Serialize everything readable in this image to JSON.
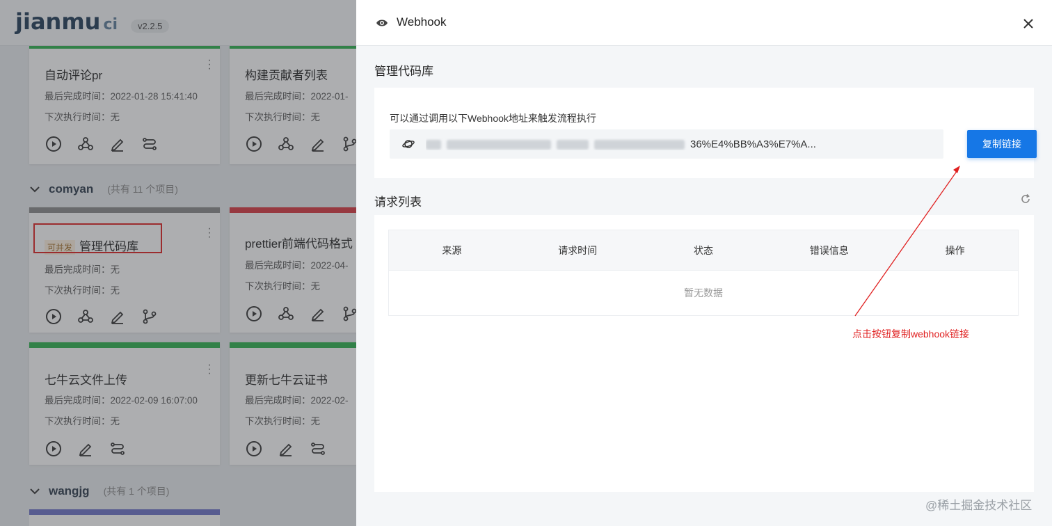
{
  "app": {
    "logo": "jianmu",
    "logo_suffix": "ci",
    "version": "v2.2.5"
  },
  "projects_top": [
    {
      "title": "自动评论pr",
      "last_label": "最后完成时间：",
      "last": "2022-01-28 15:41:40",
      "next_label": "下次执行时间：",
      "next": "无"
    },
    {
      "title": "构建贡献者列表",
      "last_label": "最后完成时间：",
      "last": "2022-01-",
      "next_label": "下次执行时间：",
      "next": "无"
    }
  ],
  "groups": [
    {
      "name": "comyan",
      "count": "(共有 11 个项目)"
    },
    {
      "name": "wangjg",
      "count": "(共有 1 个项目)"
    }
  ],
  "projects_comyan": [
    {
      "tag": "可并发",
      "title": "管理代码库",
      "last_label": "最后完成时间：",
      "last": "无",
      "next_label": "下次执行时间：",
      "next": "无"
    },
    {
      "title": "prettier前端代码格式",
      "last_label": "最后完成时间：",
      "last": "2022-04-",
      "next_label": "下次执行时间：",
      "next": "无"
    },
    {
      "title": "七牛云文件上传",
      "last_label": "最后完成时间：",
      "last": "2022-02-09 16:07:00",
      "next_label": "下次执行时间：",
      "next": "无"
    },
    {
      "title": "更新七牛云证书",
      "last_label": "最后完成时间：",
      "last": "2022-02-",
      "next_label": "下次执行时间：",
      "next": "无"
    }
  ],
  "drawer": {
    "title": "Webhook",
    "section1_title": "管理代码库",
    "description": "可以通过调用以下Webhook地址来触发流程执行",
    "url_visible": "%E7%AE%A1%E7%90%86%E4%BB%A3%E7%A...",
    "url_tail": "36%E4%BB%A3%E7%A...",
    "copy_button": "复制链接",
    "section2_title": "请求列表",
    "table_headers": [
      "来源",
      "请求时间",
      "状态",
      "错误信息",
      "操作"
    ],
    "empty_text": "暂无数据"
  },
  "annotation": "点击按钮复制webhook链接",
  "watermark": "@稀土掘金技术社区",
  "colors": {
    "primary": "#1677e6",
    "annotation": "#e02020",
    "green_bar": "#2bb24c",
    "red_bar": "#d9363e",
    "gray_bar": "#8a8a8a",
    "purple_bar": "#6d72c9"
  }
}
